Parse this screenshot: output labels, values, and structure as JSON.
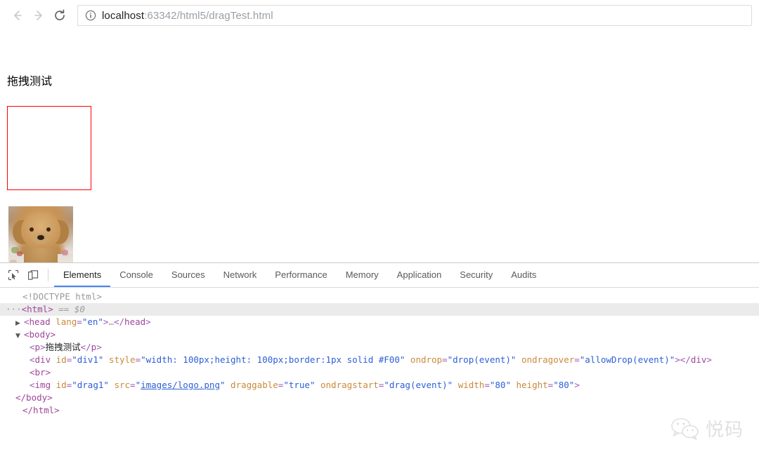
{
  "browser": {
    "back_label": "Back",
    "forward_label": "Forward",
    "reload_label": "Reload",
    "site_info_label": "View site information",
    "url_host": "localhost",
    "url_rest": ":63342/html5/dragTest.html",
    "url_full": "localhost:63342/html5/dragTest.html"
  },
  "page": {
    "heading": "拖拽测试",
    "drop_zone_border_color": "#FF0000",
    "drag_image_alt": "puppy-photo"
  },
  "devtools": {
    "inspect_icon_label": "Inspect element",
    "device_toolbar_icon_label": "Toggle device toolbar",
    "tabs": [
      {
        "label": "Elements",
        "active": true
      },
      {
        "label": "Console",
        "active": false
      },
      {
        "label": "Sources",
        "active": false
      },
      {
        "label": "Network",
        "active": false
      },
      {
        "label": "Performance",
        "active": false
      },
      {
        "label": "Memory",
        "active": false
      },
      {
        "label": "Application",
        "active": false
      },
      {
        "label": "Security",
        "active": false
      },
      {
        "label": "Audits",
        "active": false
      }
    ],
    "dom": {
      "doctype": "<!DOCTYPE html>",
      "html_open": "<html>",
      "html_selected_marker": "== $0",
      "head_line": "<head lang=\"en\">…</head>",
      "head_tag": "head",
      "head_attr_name": "lang",
      "head_attr_value": "\"en\"",
      "body_open": "<body>",
      "p_tag": "p",
      "p_text": "拖拽测试",
      "div_tag": "div",
      "div_attr_id_name": "id",
      "div_attr_id_value": "\"div1\"",
      "div_attr_style_name": "style",
      "div_attr_style_value": "\"width: 100px;height: 100px;border:1px solid #F00\"",
      "div_attr_ondrop_name": "ondrop",
      "div_attr_ondrop_value": "\"drop(event)\"",
      "div_attr_ondragover_name": "ondragover",
      "div_attr_ondragover_value": "\"allowDrop(event)\"",
      "br_line": "<br>",
      "img_tag": "img",
      "img_attr_id_name": "id",
      "img_attr_id_value": "\"drag1\"",
      "img_attr_src_name": "src",
      "img_attr_src_value": "images/logo.png",
      "img_attr_draggable_name": "draggable",
      "img_attr_draggable_value": "\"true\"",
      "img_attr_ondragstart_name": "ondragstart",
      "img_attr_ondragstart_value": "\"drag(event)\"",
      "img_attr_width_name": "width",
      "img_attr_width_value": "\"80\"",
      "img_attr_height_name": "height",
      "img_attr_height_value": "\"80\"",
      "body_close": "</body>",
      "html_close": "</html>",
      "twisty_collapsed": "▶",
      "twisty_expanded": "▼",
      "ellipsis_dots": "···"
    }
  },
  "watermark": {
    "text": "悦码",
    "icon": "wechat-icon"
  }
}
